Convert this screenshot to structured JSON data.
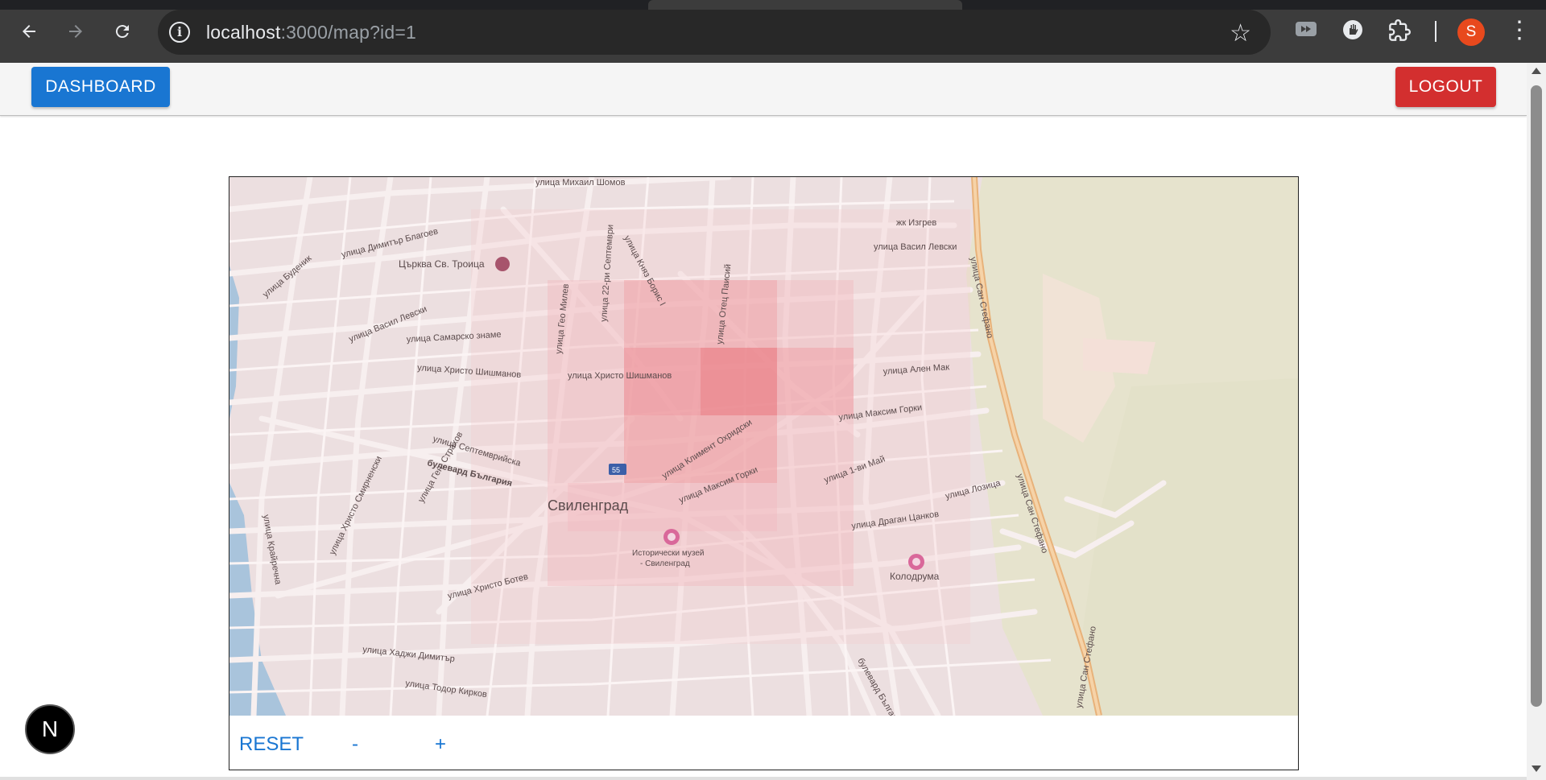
{
  "browser": {
    "url_host": "localhost",
    "url_rest": ":3000/map?id=1",
    "icons": [
      "back-arrow-icon",
      "forward-arrow-icon",
      "reload-icon",
      "site-info-icon",
      "bookmark-star-icon",
      "media-extension-icon",
      "hand-extension-icon",
      "puzzle-extensions-icon",
      "kebab-menu-icon"
    ],
    "profile_initial": "S"
  },
  "header": {
    "dashboard_label": "DASHBOARD",
    "logout_label": "LOGOUT",
    "dashboard_color": "#1976d2",
    "logout_color": "#d32f2f"
  },
  "map": {
    "labels": {
      "town": "Свиленград",
      "museum": "Исторически музей",
      "museum2": "- Свиленград",
      "church": "Църква Св. Троица",
      "kolodruma": "Колодрума",
      "route": "55",
      "st_mihail_shomov": "улица Михаил Шомов",
      "st_izgrev": "жк Изгрев",
      "st_vasil_levski_e": "улица Васил Левски",
      "st_san_stefano_1": "улица Сан Стефано",
      "st_san_stefano_2": "улица Сан Стефано",
      "st_san_stefano_3": "улица Сан Стефано",
      "st_dimitar_blagoev": "улица Димитър Благоев",
      "st_budenits": "улица Буденик",
      "st_vasil_levski_w": "улица Васил Левски",
      "st_samarsko_zname": "улица Самарско знаме",
      "st_hristo_shishmanov_w": "улица Христо Шишманов",
      "st_hristo_shishmanov_c": "улица Христо Шишманов",
      "st_knyaz_boris": "улица Княз Борис I",
      "st_otec_paisiy": "улица Отец Паисий",
      "st_geo_milev": "улица Гео Милев",
      "st_22_sept": "улица 22-ри Септември",
      "st_alen_mak": "улица Ален Мак",
      "st_maksim_gorki_1": "улица Максим Горки",
      "st_maksim_gorki_2": "улица Максим Горки",
      "st_1_vi_may": "улица 1-ви Май",
      "st_kliment": "улица Климент Охридски",
      "st_septemvriyska": "улица Септемврийска",
      "blvd_bulgaria": "булевард България",
      "blvd_bulgaria_2": "булевард България",
      "st_hristo_smirnenski": "улица Христо Смирненски",
      "st_geo_strahov": "улица Ген. Страхов",
      "st_lozitsa": "улица Лозица",
      "st_dragan_tsankov": "улица Драган Цанков",
      "st_hristo_botev": "улица Христо Ботев",
      "st_hadzhi_dimitar": "улица Хаджи Димитър",
      "st_todor_kirkov": "улица Тодор Кирков",
      "st_kray": "улица Крайречна"
    },
    "controls": {
      "reset_label": "RESET",
      "zoom_out_label": "-",
      "zoom_in_label": "+"
    }
  },
  "floating_badge": "N"
}
